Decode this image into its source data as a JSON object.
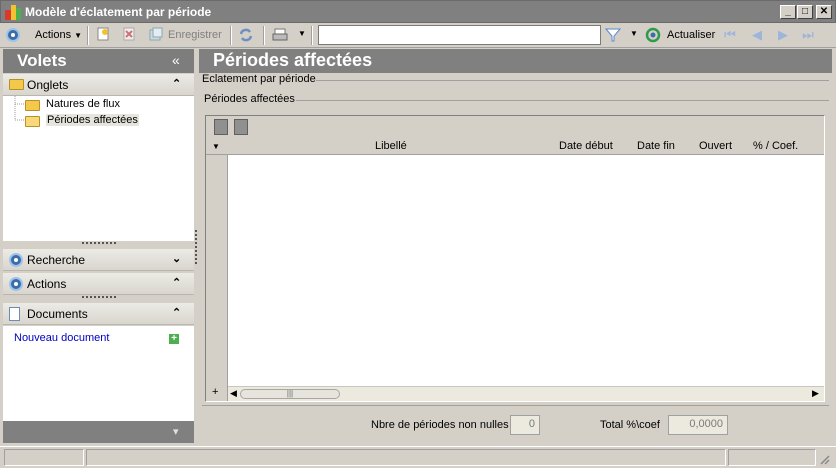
{
  "window": {
    "title": "Modèle d'éclatement par période",
    "min_label": "_",
    "max_label": "□",
    "close_label": "✕"
  },
  "toolbar": {
    "actions_label": "Actions",
    "save_label": "Enregistrer",
    "refresh_label": "Actualiser",
    "search_value": ""
  },
  "volets": {
    "title": "Volets",
    "collapse_glyph": "«",
    "sections": {
      "onglets": {
        "label": "Onglets",
        "chevron": "⌃"
      },
      "recherche": {
        "label": "Recherche",
        "chevron": "⌄"
      },
      "actions": {
        "label": "Actions",
        "chevron": "⌃"
      },
      "documents": {
        "label": "Documents",
        "chevron": "⌃"
      }
    },
    "tree_items": [
      "Natures de flux",
      "Périodes affectées"
    ],
    "new_document_label": "Nouveau document",
    "new_document_plus": "+",
    "bottom_chevron": "▾"
  },
  "main": {
    "title": "Périodes affectées",
    "group1_label": "Eclatement par période",
    "group2_label": "Périodes affectées",
    "columns": [
      "Libellé",
      "Date début",
      "Date fin",
      "Ouvert",
      "% / Coef."
    ],
    "row_expander": "+"
  },
  "footer": {
    "count_label": "Nbre de périodes non nulles",
    "count_value": "0",
    "total_label": "Total %\\coef",
    "total_value": "0,0000"
  },
  "colors": {
    "titlebar": "#808080",
    "header_grey": "#7d7d7d",
    "panel_bg": "#d4d0c8",
    "link_blue": "#0000c0",
    "accent_blue": "#3b6ea8"
  },
  "icons": [
    "app-logo-icon",
    "actions-radio-icon",
    "new-record-icon",
    "delete-icon",
    "save-icon",
    "refresh-icon",
    "print-icon",
    "filter-icon",
    "refresh-green-icon",
    "first-record-icon",
    "previous-record-icon",
    "next-record-icon",
    "last-record-icon",
    "folder-icon",
    "document-icon",
    "add-icon"
  ]
}
